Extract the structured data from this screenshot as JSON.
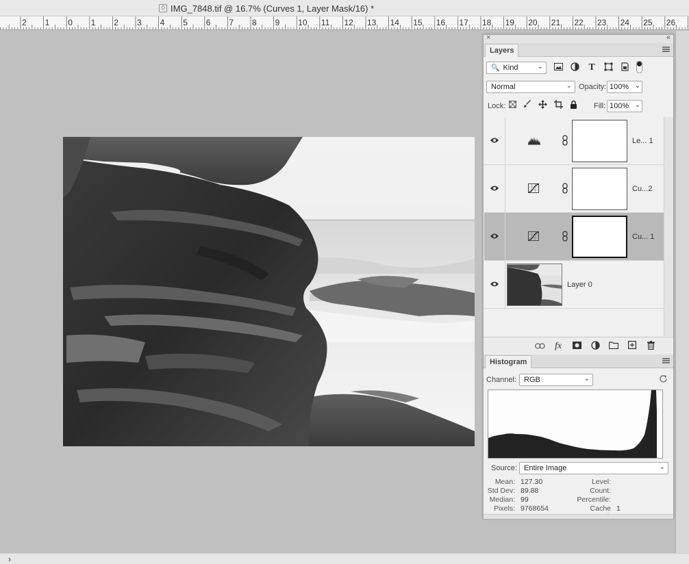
{
  "window": {
    "title": "IMG_7848.tif @ 16.7% (Curves 1, Layer Mask/16) *"
  },
  "ruler": {
    "labels": [
      "2",
      "1",
      "0",
      "1",
      "2",
      "3",
      "4",
      "5",
      "6",
      "7",
      "8",
      "9",
      "10",
      "11",
      "12",
      "13",
      "14",
      "15",
      "16",
      "17",
      "18",
      "19",
      "20",
      "21",
      "22",
      "23",
      "24",
      "25",
      "26"
    ]
  },
  "panel": {
    "close_glyph": "×",
    "collapse_glyph": "«"
  },
  "layers_panel": {
    "tab_label": "Layers",
    "filter": {
      "value": "Kind"
    },
    "blend_mode": "Normal",
    "opacity_label": "Opacity:",
    "opacity_value": "100%",
    "lock_label": "Lock:",
    "fill_label": "Fill:",
    "fill_value": "100%",
    "layers": [
      {
        "name": "Le... 1",
        "kind": "levels",
        "selected": false,
        "icon": "levels-icon"
      },
      {
        "name": "Cu...2",
        "kind": "curves",
        "selected": false,
        "icon": "curves-icon"
      },
      {
        "name": "Cu... 1",
        "kind": "curves",
        "selected": true,
        "icon": "curves-icon"
      },
      {
        "name": "Layer 0",
        "kind": "pixel",
        "selected": false,
        "icon": "image-thumbnail"
      }
    ]
  },
  "histogram_panel": {
    "tab_label": "Histogram",
    "channel_label": "Channel:",
    "channel_value": "RGB",
    "source_label": "Source:",
    "source_value": "Entire Image",
    "stats": {
      "mean_label": "Mean:",
      "mean_value": "127.30",
      "stddev_label": "Std Dev:",
      "stddev_value": "89.88",
      "median_label": "Median:",
      "median_value": "99",
      "pixels_label": "Pixels:",
      "pixels_value": "9768654",
      "level_label": "Level:",
      "level_value": "",
      "count_label": "Count:",
      "count_value": "",
      "percentile_label": "Percentile:",
      "percentile_value": "",
      "cache_label": "Cache Level:",
      "cache_value": "1"
    }
  },
  "status": {
    "chevron": "›"
  },
  "colors": {
    "canvas_bg": "#c0c0c0",
    "panel_bg": "#f0f0f0",
    "selected_row": "#b9b9b9"
  }
}
